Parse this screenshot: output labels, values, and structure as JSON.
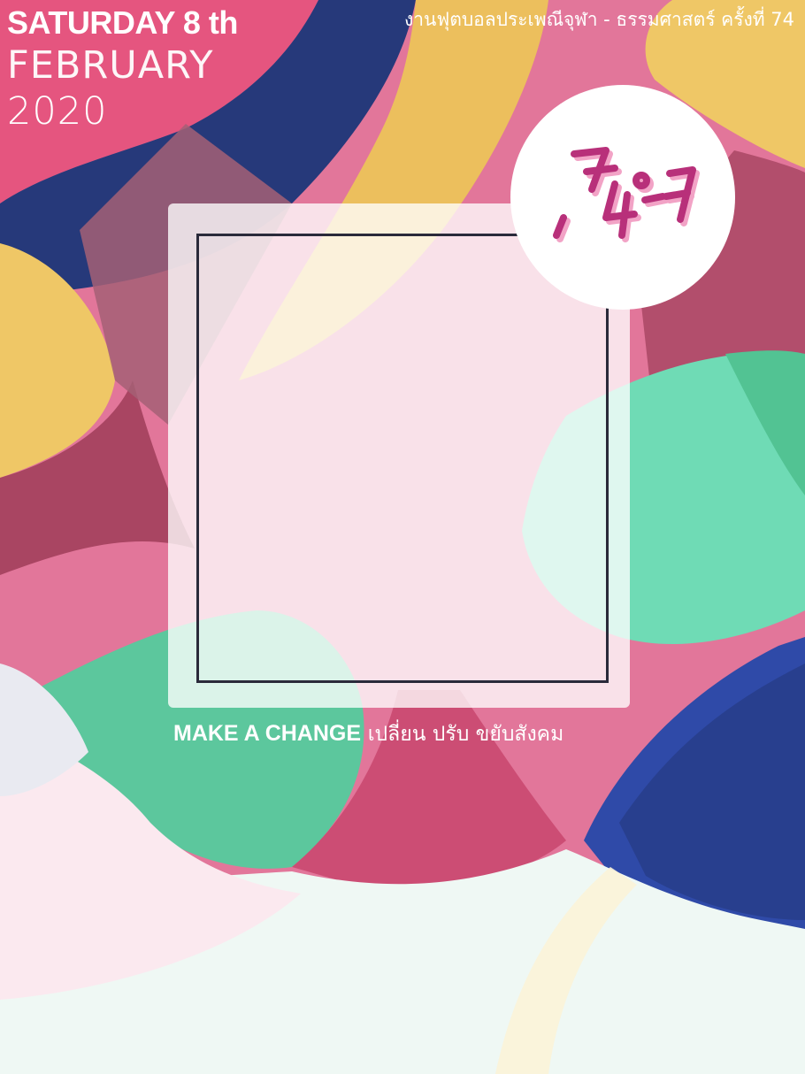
{
  "poster": {
    "date_day": "SATURDAY 8 th",
    "date_month": "FEBRUARY",
    "date_year": "2020",
    "event_title": "งานฟุตบอลประเพณีจุฬา - ธรรมศาสตร์ ครั้งที่ 74",
    "tagline_en": "MAKE A CHANGE",
    "tagline_th": "เปลี่ยน ปรับ ขยับสังคม",
    "logo_icon": "74-cu-tu-logo-icon"
  },
  "colors": {
    "pink": "#e2769a",
    "hot_pink": "#e5557f",
    "navy": "#26397a",
    "yellow": "#ecbf5d",
    "mint": "#6ad8b2",
    "green": "#52c393",
    "blue": "#2f4aa8",
    "light": "#eff7f4",
    "logo_magenta": "#b8307a"
  }
}
